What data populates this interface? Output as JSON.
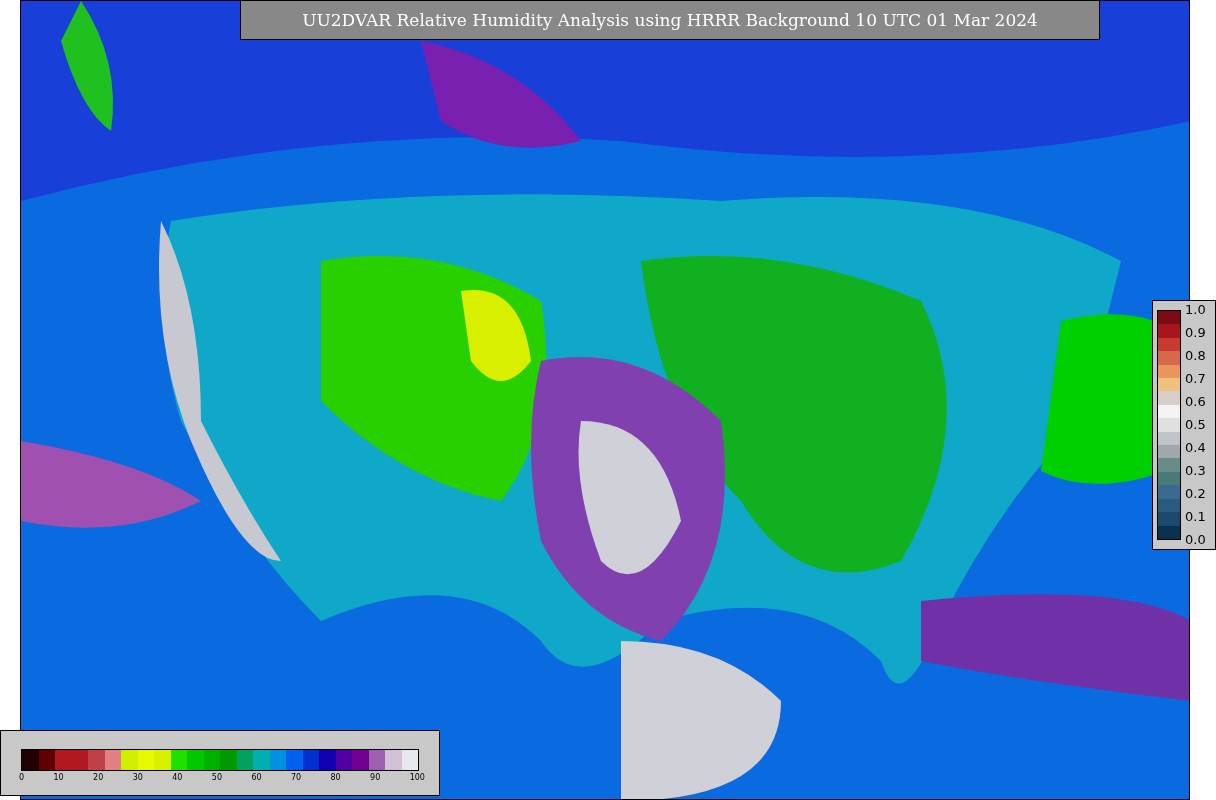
{
  "title": "UU2DVAR Relative Humidity Analysis using HRRR Background 10 UTC 01 Mar 2024",
  "legend_right": {
    "ticks": [
      "1.0",
      "0.9",
      "0.8",
      "0.7",
      "0.6",
      "0.5",
      "0.4",
      "0.3",
      "0.2",
      "0.1",
      "0.0"
    ],
    "segments": [
      {
        "color": "#7a0a14"
      },
      {
        "color": "#a8141c"
      },
      {
        "color": "#c83a2c"
      },
      {
        "color": "#d8684a"
      },
      {
        "color": "#e8965e"
      },
      {
        "color": "#f0c080"
      },
      {
        "color": "#d8d0c8"
      },
      {
        "color": "#f4f4f4"
      },
      {
        "color": "#e0e0e0"
      },
      {
        "color": "#c0c4c8"
      },
      {
        "color": "#a0a8ac"
      },
      {
        "color": "#688c88"
      },
      {
        "color": "#4a7a78"
      },
      {
        "color": "#3a6a90"
      },
      {
        "color": "#2a5a80"
      },
      {
        "color": "#1a4a70"
      },
      {
        "color": "#0a3050"
      }
    ]
  },
  "legend_bottom": {
    "ticks": [
      "0",
      "10",
      "20",
      "30",
      "40",
      "50",
      "60",
      "70",
      "80",
      "90",
      "100"
    ],
    "segments": [
      {
        "color": "#200000"
      },
      {
        "color": "#600000"
      },
      {
        "color": "#b01820"
      },
      {
        "color": "#b01821"
      },
      {
        "color": "#c04048"
      },
      {
        "color": "#e08080"
      },
      {
        "color": "#d0f000"
      },
      {
        "color": "#e8f800"
      },
      {
        "color": "#d8f000"
      },
      {
        "color": "#20e000"
      },
      {
        "color": "#00c800"
      },
      {
        "color": "#00b000"
      },
      {
        "color": "#009800"
      },
      {
        "color": "#00a060"
      },
      {
        "color": "#00b0b0"
      },
      {
        "color": "#0090e0"
      },
      {
        "color": "#0060f0"
      },
      {
        "color": "#0030d0"
      },
      {
        "color": "#1000b0"
      },
      {
        "color": "#5000a0"
      },
      {
        "color": "#700090"
      },
      {
        "color": "#a060b0"
      },
      {
        "color": "#d0c0d8"
      },
      {
        "color": "#e8e8f0"
      }
    ]
  }
}
